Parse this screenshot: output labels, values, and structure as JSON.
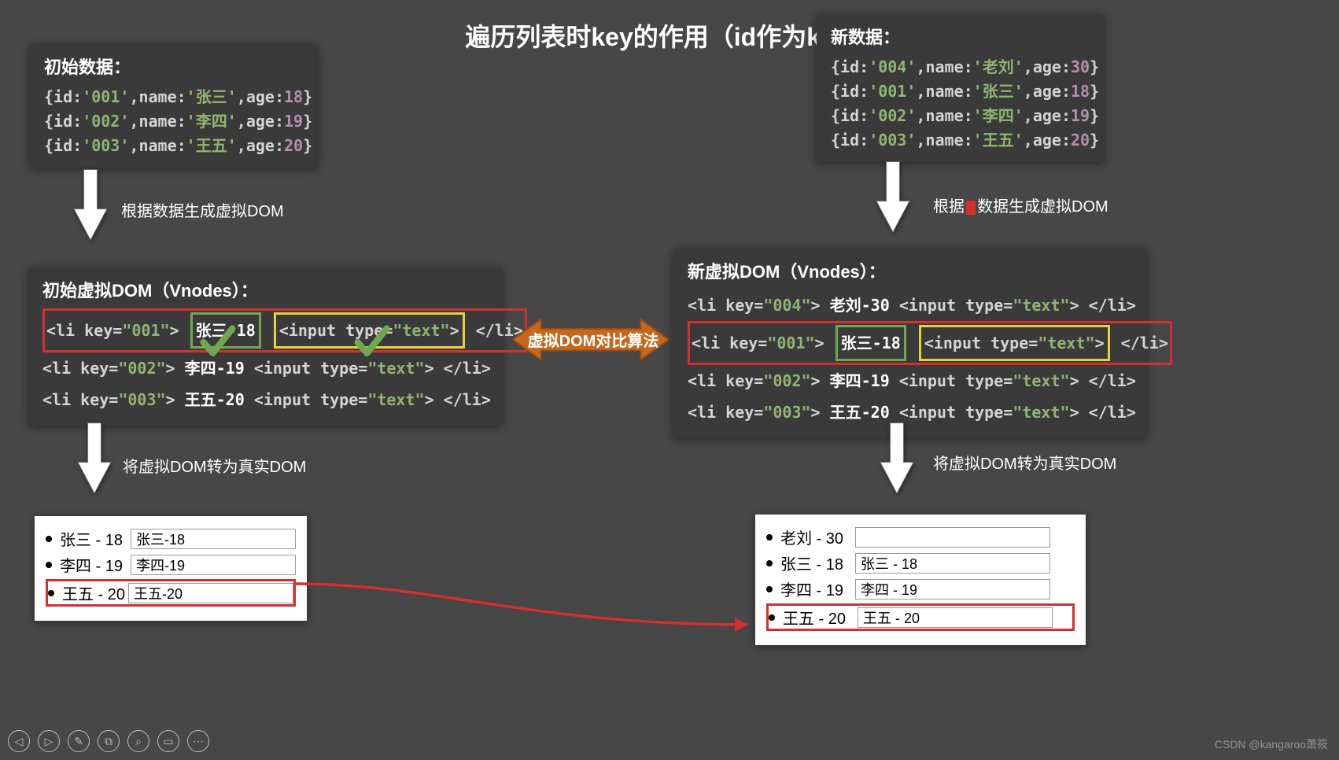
{
  "title": "遍历列表时key的作用（id作为key）",
  "initialData": {
    "label": "初始数据：",
    "rows": [
      {
        "id": "001",
        "name": "张三",
        "age": 18
      },
      {
        "id": "002",
        "name": "李四",
        "age": 19
      },
      {
        "id": "003",
        "name": "王五",
        "age": 20
      }
    ]
  },
  "newData": {
    "label": "新数据：",
    "rows": [
      {
        "id": "004",
        "name": "老刘",
        "age": 30
      },
      {
        "id": "001",
        "name": "张三",
        "age": 18
      },
      {
        "id": "002",
        "name": "李四",
        "age": 19
      },
      {
        "id": "003",
        "name": "王五",
        "age": 20
      }
    ]
  },
  "step_labels": {
    "gen_left": "根据数据生成虚拟DOM",
    "gen_right_before": "根据",
    "gen_right_after": "数据生成虚拟DOM",
    "to_real_left": "将虚拟DOM转为真实DOM",
    "to_real_right": "将虚拟DOM转为真实DOM"
  },
  "vnodes_left": {
    "label": "初始虚拟DOM（Vnodes）：",
    "rows": [
      {
        "key": "001",
        "text": "张三-18",
        "hl": true
      },
      {
        "key": "002",
        "text": "李四-19",
        "hl": false
      },
      {
        "key": "003",
        "text": "王五-20",
        "hl": false
      }
    ]
  },
  "vnodes_right": {
    "label": "新虚拟DOM（Vnodes）：",
    "rows": [
      {
        "key": "004",
        "text": "老刘-30",
        "hl": false
      },
      {
        "key": "001",
        "text": "张三-18",
        "hl": true
      },
      {
        "key": "002",
        "text": "李四-19",
        "hl": false
      },
      {
        "key": "003",
        "text": "王五-20",
        "hl": false
      }
    ]
  },
  "diff_label": "虚拟DOM对比算法",
  "realdom_left": {
    "rows": [
      {
        "label": "张三 - 18",
        "value": "张三-18",
        "hl": false
      },
      {
        "label": "李四 - 19",
        "value": "李四-19",
        "hl": false
      },
      {
        "label": "王五 - 20",
        "value": "王五-20",
        "hl": true
      }
    ]
  },
  "realdom_right": {
    "rows": [
      {
        "label": "老刘 - 30",
        "value": "",
        "hl": false
      },
      {
        "label": "张三 - 18",
        "value": "张三 - 18",
        "hl": false
      },
      {
        "label": "李四 - 19",
        "value": "李四 - 19",
        "hl": false
      },
      {
        "label": "王五 - 20",
        "value": "王五 - 20",
        "hl": true
      }
    ]
  },
  "toolbar": {
    "prev": "◁",
    "next": "▷",
    "pen": "✎",
    "layers": "⧉",
    "zoom": "⌕",
    "fit": "▭",
    "more": "⋯"
  },
  "watermark": "CSDN @kangaroo萧筱"
}
